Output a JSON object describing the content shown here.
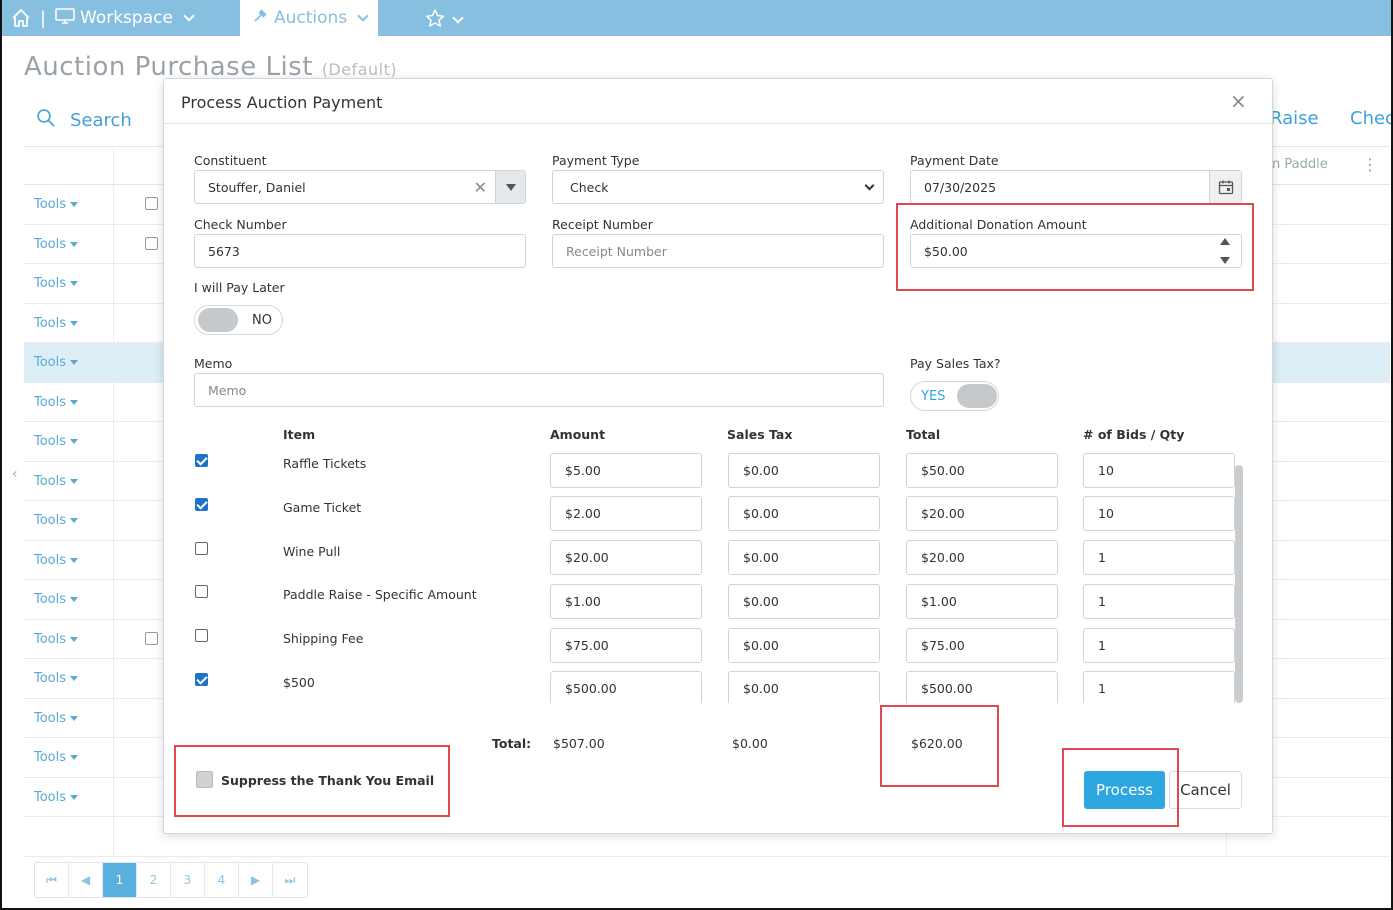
{
  "nav": {
    "workspace": "Workspace",
    "auctions": "Auctions"
  },
  "page": {
    "title": "Auction Purchase List",
    "view": "(Default)",
    "search": "Search",
    "raise": "Raise",
    "check": "Chec",
    "paddle_col": "n Paddle",
    "tools_label": "Tools",
    "pages": [
      "1",
      "2",
      "3",
      "4"
    ]
  },
  "modal": {
    "title": "Process Auction Payment",
    "constituent_label": "Constituent",
    "constituent_value": "Stouffer, Daniel",
    "payment_type_label": "Payment Type",
    "payment_type_value": "Check",
    "payment_date_label": "Payment Date",
    "payment_date_value": "07/30/2025",
    "check_number_label": "Check Number",
    "check_number_value": "5673",
    "receipt_number_label": "Receipt Number",
    "receipt_number_placeholder": "Receipt Number",
    "additional_donation_label": "Additional Donation Amount",
    "additional_donation_value": "$50.00",
    "pay_later_label": "I will Pay Later",
    "pay_later_value": "NO",
    "memo_label": "Memo",
    "memo_placeholder": "Memo",
    "sales_tax_label": "Pay Sales Tax?",
    "sales_tax_value": "YES",
    "columns": {
      "item": "Item",
      "amount": "Amount",
      "sales_tax": "Sales Tax",
      "total": "Total",
      "qty": "# of Bids / Qty"
    },
    "items": [
      {
        "name": "Raffle Tickets",
        "checked": true,
        "amount": "$5.00",
        "tax": "$0.00",
        "total": "$50.00",
        "qty": "10"
      },
      {
        "name": "Game Ticket",
        "checked": true,
        "amount": "$2.00",
        "tax": "$0.00",
        "total": "$20.00",
        "qty": "10"
      },
      {
        "name": "Wine Pull",
        "checked": false,
        "amount": "$20.00",
        "tax": "$0.00",
        "total": "$20.00",
        "qty": "1"
      },
      {
        "name": "Paddle Raise - Specific Amount",
        "checked": false,
        "amount": "$1.00",
        "tax": "$0.00",
        "total": "$1.00",
        "qty": "1"
      },
      {
        "name": "Shipping Fee",
        "checked": false,
        "amount": "$75.00",
        "tax": "$0.00",
        "total": "$75.00",
        "qty": "1"
      },
      {
        "name": "$500",
        "checked": true,
        "amount": "$500.00",
        "tax": "$0.00",
        "total": "$500.00",
        "qty": "1"
      }
    ],
    "totals_label": "Total:",
    "total_amount": "$507.00",
    "total_tax": "$0.00",
    "grand_total": "$620.00",
    "suppress_email_label": "Suppress the Thank You Email",
    "process_button": "Process",
    "cancel_button": "Cancel"
  },
  "colors": {
    "nav_bg": "#86bfe0",
    "accent": "#2ea7e0",
    "highlight": "#e04850"
  }
}
